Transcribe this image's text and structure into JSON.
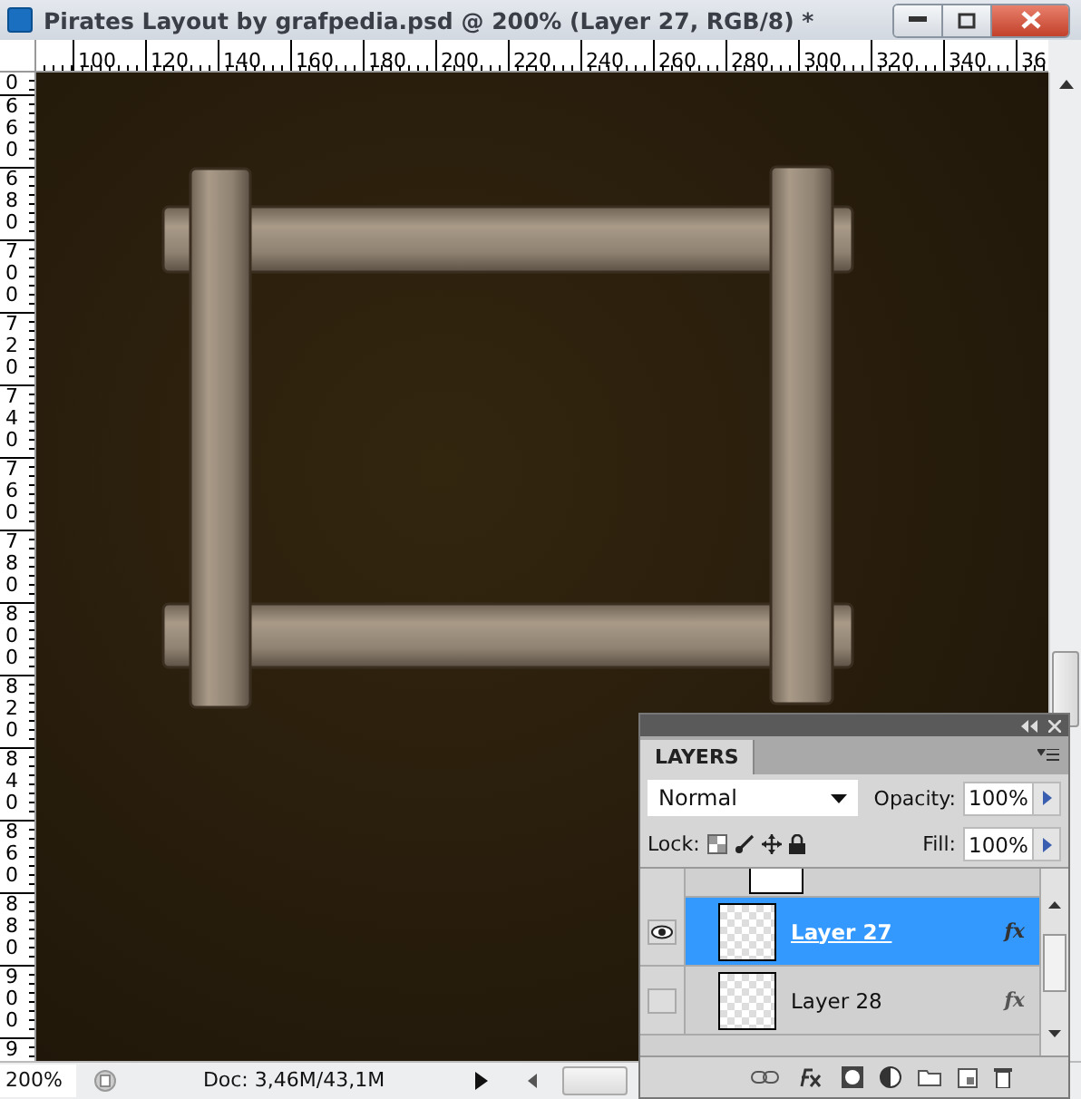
{
  "window": {
    "title": "Pirates Layout by grafpedia.psd @ 200% (Layer 27, RGB/8) *"
  },
  "ruler_top": {
    "labels": [
      "100",
      "120",
      "140",
      "160",
      "180",
      "200",
      "220",
      "240",
      "260",
      "280",
      "300",
      "320",
      "340",
      "36"
    ]
  },
  "ruler_left": {
    "labels": [
      "0",
      "660",
      "680",
      "700",
      "720",
      "740",
      "760",
      "780",
      "800",
      "820",
      "840",
      "860",
      "880",
      "900",
      "9"
    ]
  },
  "layers_panel": {
    "tab": "LAYERS",
    "blend_mode": "Normal",
    "opacity_label": "Opacity:",
    "opacity": "100%",
    "lock_label": "Lock:",
    "fill_label": "Fill:",
    "fill": "100%",
    "layers": [
      {
        "name": "Layer 27",
        "visible": true,
        "selected": true,
        "fx": "fx"
      },
      {
        "name": "Layer 28",
        "visible": false,
        "selected": false,
        "fx": "fx"
      }
    ]
  },
  "status_bar": {
    "zoom": "200%",
    "doc": "Doc: 3,46M/43,1M"
  }
}
